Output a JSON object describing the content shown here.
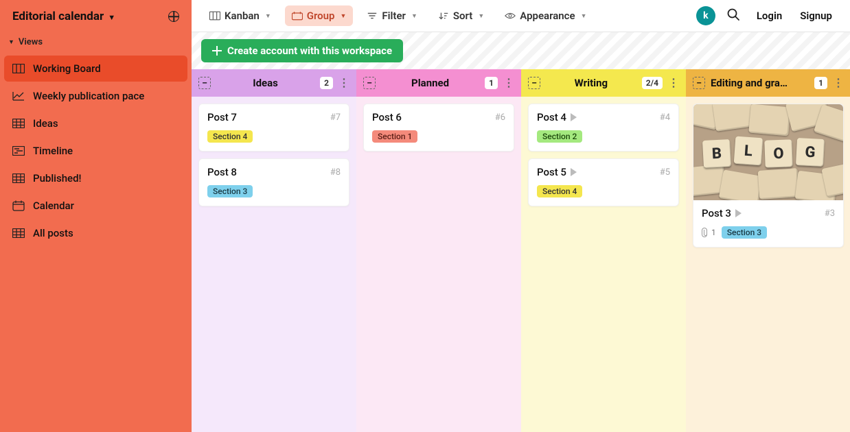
{
  "sidebar": {
    "title": "Editorial calendar",
    "views_label": "Views",
    "items": [
      {
        "label": "Working Board",
        "active": true
      },
      {
        "label": "Weekly publication pace"
      },
      {
        "label": "Ideas"
      },
      {
        "label": "Timeline"
      },
      {
        "label": "Published!"
      },
      {
        "label": "Calendar"
      },
      {
        "label": "All posts"
      }
    ]
  },
  "topbar": {
    "kanban": "Kanban",
    "group": "Group",
    "filter": "Filter",
    "sort": "Sort",
    "appearance": "Appearance",
    "login": "Login",
    "signup": "Signup",
    "avatar_initial": "k"
  },
  "banner": {
    "cta": "Create account with this workspace"
  },
  "columns": [
    {
      "title": "Ideas",
      "count": "2",
      "cards": [
        {
          "title": "Post 7",
          "num": "#7",
          "tag": "Section 4",
          "tag_class": "tag-yellow"
        },
        {
          "title": "Post 8",
          "num": "#8",
          "tag": "Section 3",
          "tag_class": "tag-blue"
        }
      ]
    },
    {
      "title": "Planned",
      "count": "1",
      "cards": [
        {
          "title": "Post 6",
          "num": "#6",
          "tag": "Section 1",
          "tag_class": "tag-red"
        }
      ]
    },
    {
      "title": "Writing",
      "count": "2/4",
      "cards": [
        {
          "title": "Post 4",
          "num": "#4",
          "tag": "Section 2",
          "tag_class": "tag-green",
          "subtask": true
        },
        {
          "title": "Post 5",
          "num": "#5",
          "tag": "Section 4",
          "tag_class": "tag-yellow",
          "subtask": true
        }
      ]
    },
    {
      "title": "Editing and gra…",
      "count": "1",
      "cards": [
        {
          "title": "Post 3",
          "num": "#3",
          "tag": "Section 3",
          "tag_class": "tag-blue",
          "subtask": true,
          "image": true,
          "attachments": "1"
        }
      ]
    }
  ]
}
